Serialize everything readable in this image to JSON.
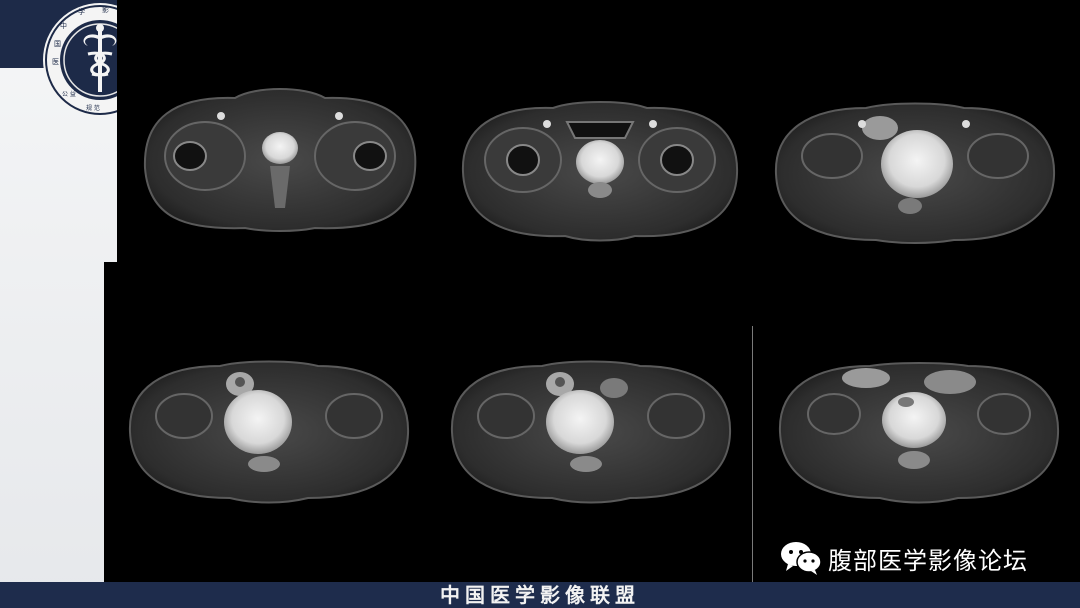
{
  "logo": {
    "icon": "medical-caduceus-seal-icon",
    "seal_text": "中 国 医 学 影 像 联 盟"
  },
  "footer": {
    "title": "中国医学影像联盟"
  },
  "watermark": {
    "icon": "wechat-icon",
    "text": "腹部医学影像论坛"
  },
  "colors": {
    "header_band": "#1d2a48",
    "footer_band": "#1e2c4c",
    "slide_background": "#eceef0",
    "image_background": "#000000"
  }
}
